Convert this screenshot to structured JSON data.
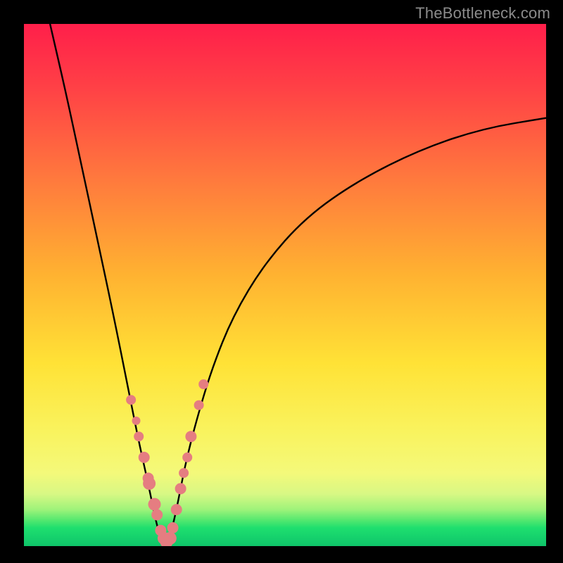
{
  "watermark": "TheBottleneck.com",
  "colors": {
    "curve": "#000000",
    "marker_fill": "#e57d81",
    "marker_stroke": "#d96e73"
  },
  "chart_data": {
    "type": "line",
    "title": "",
    "xlabel": "",
    "ylabel": "",
    "xlim": [
      0,
      100
    ],
    "ylim": [
      0,
      100
    ],
    "grid": false,
    "curve": {
      "description": "V-shaped bottleneck curve: steep descent to ~0 at x≈27, then asymptotic rise toward ~82",
      "minimum_x": 27,
      "minimum_y": 0,
      "left_top_y": 100,
      "right_end_x": 100,
      "right_end_y": 82,
      "samples_x": [
        5,
        8,
        11,
        14,
        17,
        20,
        22,
        24,
        25,
        26,
        27,
        28,
        29,
        30,
        31,
        33,
        36,
        40,
        46,
        54,
        64,
        76,
        88,
        100
      ],
      "samples_y": [
        100,
        87,
        73,
        59,
        45,
        30,
        20,
        11,
        6,
        2,
        0,
        2,
        6,
        11,
        16,
        24,
        34,
        44,
        54,
        63,
        70,
        76,
        80,
        82
      ]
    },
    "series": [
      {
        "name": "markers",
        "x": [
          20.5,
          21.5,
          22.0,
          23.0,
          23.8,
          24.0,
          25.0,
          25.5,
          26.2,
          26.8,
          27.3,
          28.0,
          28.5,
          29.2,
          30.0,
          30.6,
          31.3,
          32.0,
          33.5,
          34.4
        ],
        "y": [
          28,
          24,
          21,
          17,
          13,
          12,
          8,
          6,
          3,
          1.5,
          0.8,
          1.5,
          3.5,
          7,
          11,
          14,
          17,
          21,
          27,
          31
        ],
        "r": [
          7,
          6,
          7,
          8,
          8,
          9,
          9,
          8,
          8,
          9,
          9,
          9,
          8,
          8,
          8,
          7,
          7,
          8,
          7,
          7
        ]
      }
    ]
  }
}
